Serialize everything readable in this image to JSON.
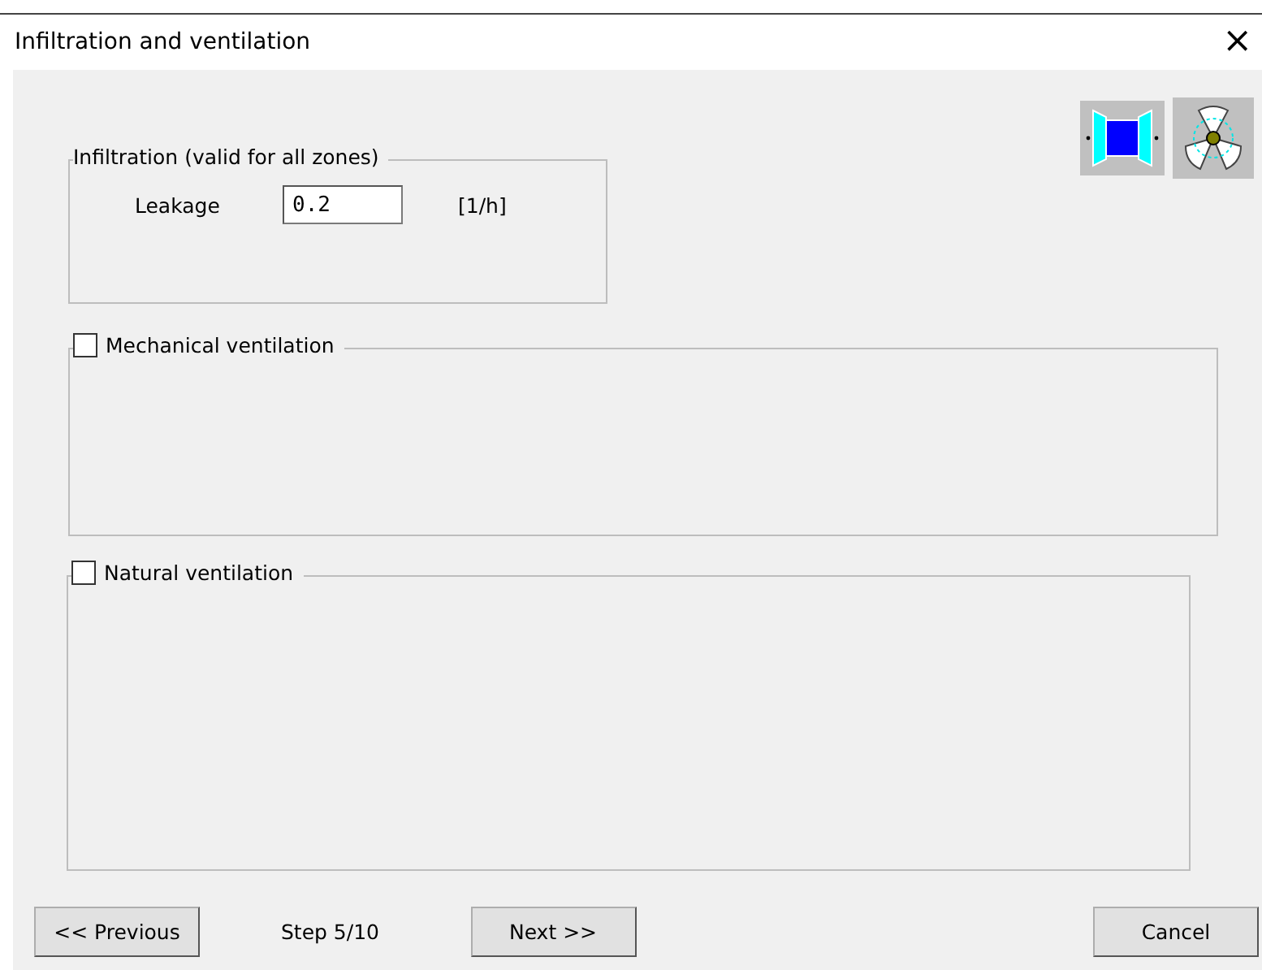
{
  "window": {
    "title": "Infiltration and ventilation",
    "close": "×"
  },
  "groups": [
    {
      "kind": "fields",
      "title": "Infiltration (valid for all zones)",
      "label": "Leakage",
      "value": "0.2",
      "unit": "[1/h]"
    },
    {
      "kind": "checkbox",
      "title": "Mechanical ventilation",
      "checked": false
    },
    {
      "kind": "checkbox",
      "title": "Natural ventilation",
      "checked": false
    }
  ],
  "footer": {
    "previous": "<< Previous",
    "step": "Step 5/10",
    "next": "Next >>",
    "cancel": "Cancel"
  }
}
